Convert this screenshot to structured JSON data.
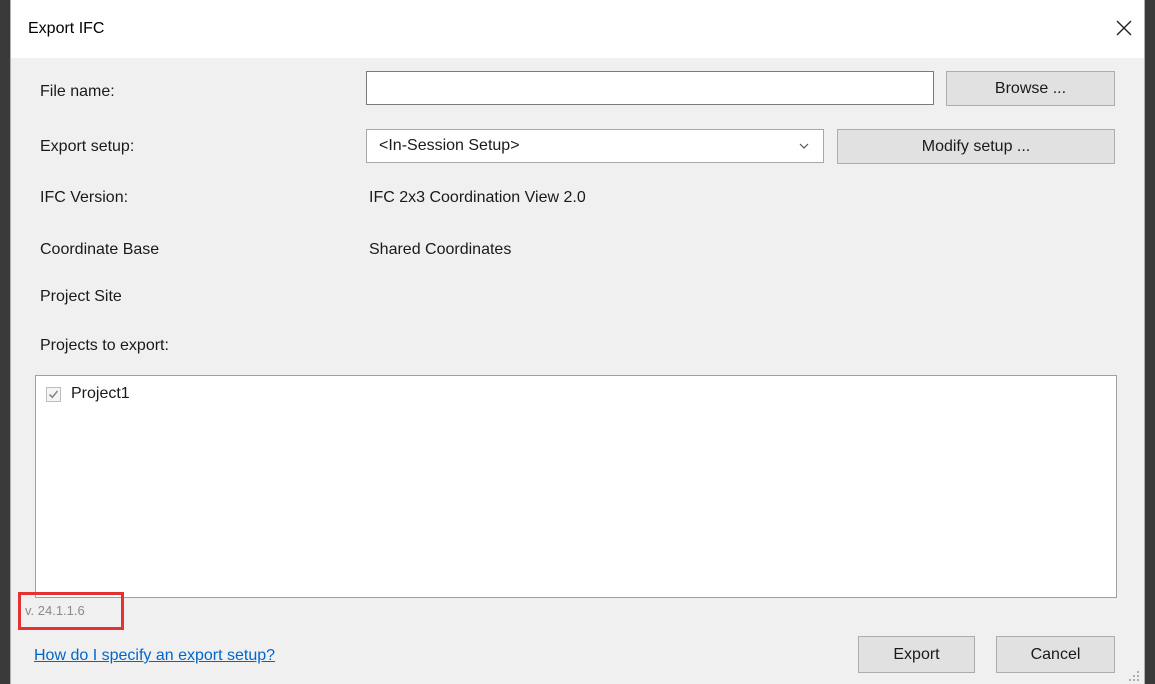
{
  "window": {
    "title": "Export IFC"
  },
  "fields": {
    "file_name_label": "File name:",
    "file_name_value": "",
    "browse_label": "Browse ...",
    "export_setup_label": "Export setup:",
    "export_setup_value": "<In-Session Setup>",
    "modify_setup_label": "Modify setup ...",
    "ifc_version_label": "IFC Version:",
    "ifc_version_value": "IFC 2x3 Coordination View 2.0",
    "coordinate_base_label": "Coordinate Base",
    "coordinate_base_value": "Shared Coordinates",
    "project_site_label": "Project Site",
    "projects_label": "Projects to export:"
  },
  "projects": [
    {
      "name": "Project1",
      "checked": true
    }
  ],
  "footer": {
    "version": "v. 24.1.1.6",
    "help_link": "How do I specify an export setup?",
    "export_label": "Export",
    "cancel_label": "Cancel"
  },
  "colors": {
    "highlight": "#e3322f",
    "link": "#0066cc"
  }
}
